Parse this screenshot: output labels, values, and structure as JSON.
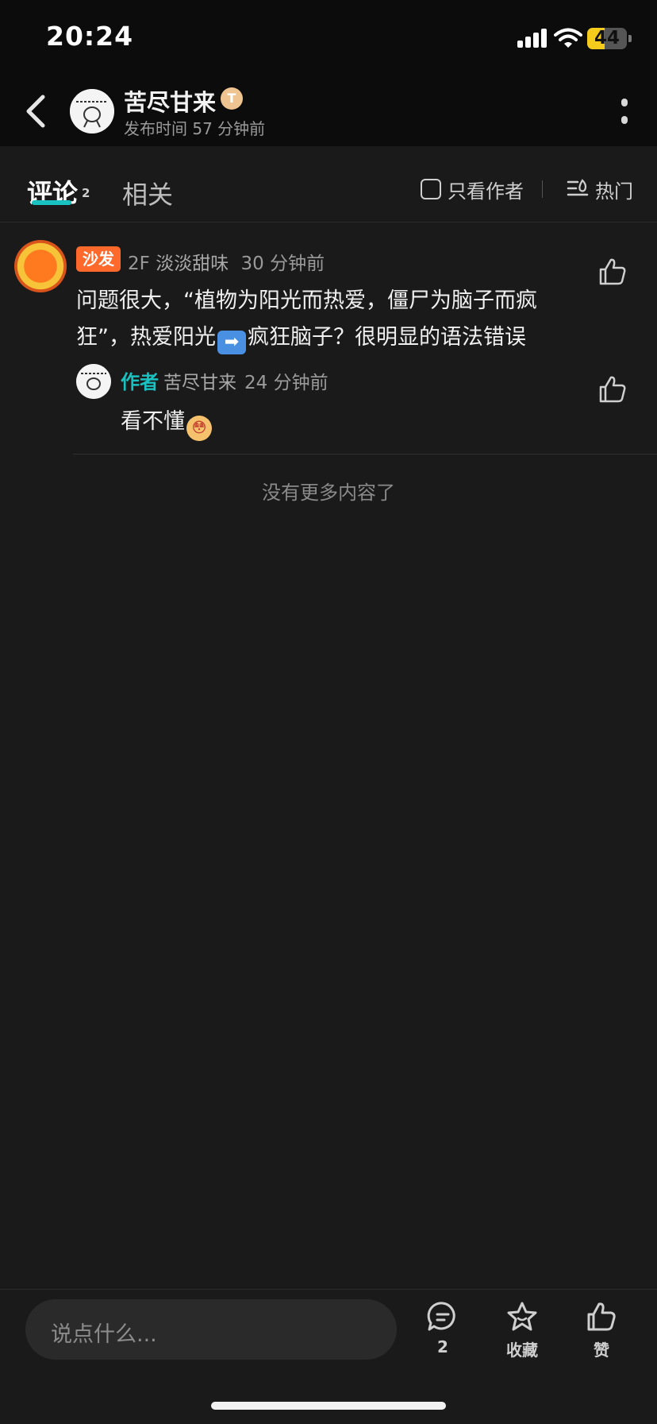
{
  "status_bar": {
    "time": "20:24",
    "battery": "44",
    "battery_fraction": 0.44
  },
  "nav": {
    "back_icon": "chevron-left-icon",
    "author_name": "苦尽甘来",
    "author_badge": "T",
    "publish_time": "发布时间 57 分钟前",
    "more_icon": "more-vertical-icon"
  },
  "tabs": {
    "comments_label": "评论",
    "comments_count": "2",
    "related_label": "相关",
    "author_only_label": "只看作者",
    "sort_label": "热门"
  },
  "comments": [
    {
      "tag": "沙发",
      "floor": "2F",
      "user": "淡淡甜味",
      "time": "30 分钟前",
      "text_before": "问题很大，“植物为阳光而热爱，僵尸为脑子而疯狂”，热爱阳光",
      "emoji": "➡",
      "text_after": "疯狂脑子？很明显的语法错误",
      "replies": [
        {
          "author_tag": "作者",
          "user": "苦尽甘来",
          "time": "24 分钟前",
          "text": "看不懂",
          "emoji": "😳"
        }
      ]
    }
  ],
  "list_end": "没有更多内容了",
  "bottom_bar": {
    "input_placeholder": "说点什么...",
    "comment_count": "2",
    "collect_label": "收藏",
    "like_label": "赞"
  },
  "colors": {
    "background": "#1a1a1a",
    "accent": "#19c2c0",
    "sofa_tag": "#ff6a2c",
    "battery": "#f5cc1c"
  }
}
